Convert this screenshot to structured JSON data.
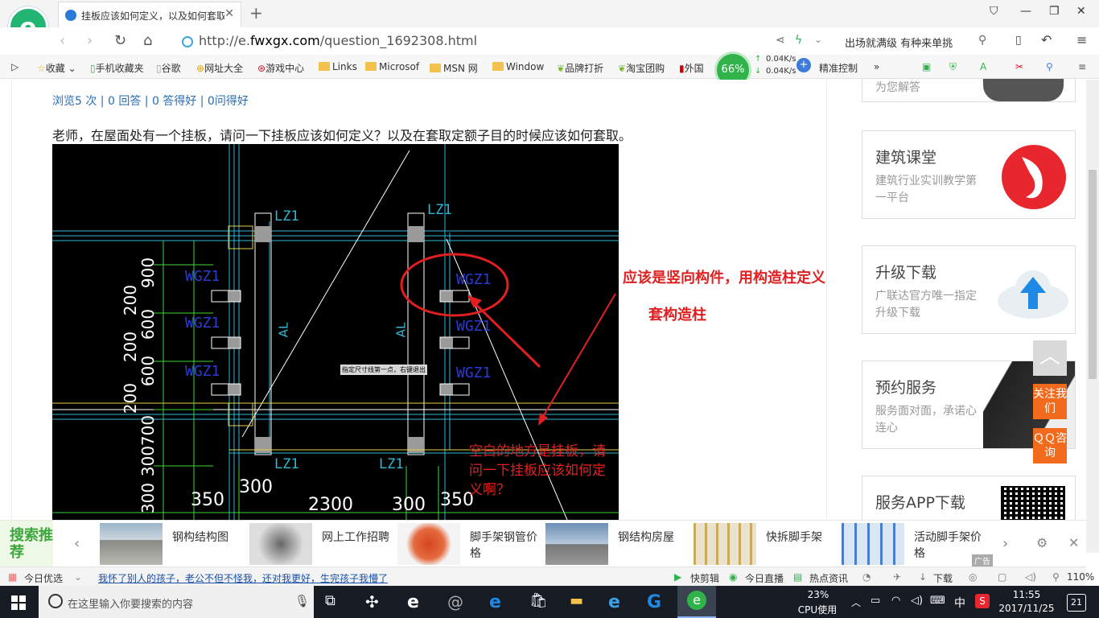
{
  "browser": {
    "tab_title": "挂板应该如何定义，以及如何套取定额",
    "url_prefix": "http://e.",
    "url_domain": "fwxgx.com",
    "url_path": "/question_1692308.html",
    "slogan": "出场就满级 有种来单挑",
    "bookmarks": [
      "收藏",
      "手机收藏夹",
      "谷歌",
      "网址大全",
      "游戏中心",
      "Links",
      "Microsof",
      "MSN 网",
      "Window",
      "品牌打折",
      "淘宝团购",
      "外国"
    ],
    "bookmark_extra": "精准控制",
    "speed": {
      "percent": "66%",
      "up": "0.04K/s",
      "down": "0.04K/s"
    }
  },
  "question": {
    "stats": "浏览5 次 | 0 回答 | 0 答得好 | 0问得好",
    "text": "老师，在屋面处有一个挂板，请问一下挂板应该如何定义？以及在套取定额子目的时候应该如何套取。"
  },
  "cad": {
    "labels_lz": [
      "LZ1",
      "LZ1",
      "LZ1",
      "LZ1"
    ],
    "labels_wgz": [
      "WGZ1",
      "WGZ1",
      "WGZ1",
      "WGZ1",
      "WGZ1",
      "WGZ1"
    ],
    "al": [
      "AL",
      "AL"
    ],
    "dims_left": [
      "900",
      "200",
      "600",
      "200",
      "600",
      "200",
      "700",
      "300",
      "300"
    ],
    "dims_bottom": [
      "350",
      "300",
      "2300",
      "300",
      "350"
    ],
    "tip": "指定尺寸线第一点，右键退出",
    "annotation1": "应该是竖向构件，用构造柱定义",
    "annotation2": "套构造柱",
    "annotation3": "空白的地方是挂板，请问一下挂板应该如何定义啊？"
  },
  "sidebar": {
    "top_partial": "为您解答",
    "cards": [
      {
        "title": "建筑课堂",
        "sub": "建筑行业实训教学第一平台"
      },
      {
        "title": "升级下载",
        "sub": "广联达官方唯一指定升级下载"
      },
      {
        "title": "预约服务",
        "sub": "服务面对面，承诺心连心"
      },
      {
        "title": "服务APP下载",
        "sub": ""
      }
    ],
    "float_follow": "关注我们",
    "float_qq": "ＱＱ咨询"
  },
  "recommend": {
    "label": "搜索推荐",
    "items": [
      "钢构结构图",
      "网上工作招聘",
      "脚手架钢管价格",
      "钢结构房屋",
      "快拆脚手架",
      "活动脚手架价格"
    ],
    "ad": "广告"
  },
  "statusbar": {
    "today": "今日优选",
    "headline": "我怀了别人的孩子，老公不但不怪我，还对我更好，生完孩子我懵了",
    "items": [
      "快剪辑",
      "今日直播",
      "热点资讯",
      "下载"
    ],
    "zoom": "110%"
  },
  "taskbar": {
    "search_placeholder": "在这里输入你要搜索的内容",
    "cpu_percent": "23%",
    "cpu_label": "CPU使用",
    "ime": "中",
    "time": "11:55",
    "date": "2017/11/25",
    "notif": "21"
  }
}
